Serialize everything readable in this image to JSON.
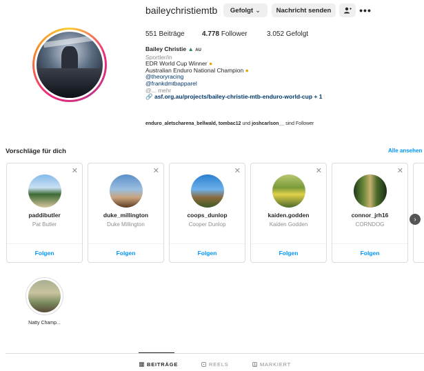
{
  "profile": {
    "username": "baileychristiemtb",
    "following_button": "Gefolgt",
    "message_button": "Nachricht senden",
    "more_icon": "more-icon",
    "stats": {
      "posts": "551 Beiträge",
      "followers_num": "4.778",
      "followers_label": "Follower",
      "following": "3.052 Gefolgt"
    },
    "bio": {
      "name": "Bailey Christie",
      "flag": "AU",
      "category": "Sportler/in",
      "line1": "EDR World Cup Winner",
      "line2": "Australian Enduro National Champion",
      "mention1": "@theoryracing",
      "mention2": "@frankdmtbapparel",
      "more": "@... mehr",
      "link": "asf.org.au/projects/bailey-christie-mtb-enduro-world-cup + 1"
    },
    "followed_by": {
      "users": "enduro_aletscharena_bellwald, tombac12",
      "conj": "und",
      "user3": "joshcarlson__",
      "suffix": "sind Follower"
    }
  },
  "suggestions": {
    "title": "Vorschläge für dich",
    "see_all": "Alle ansehen",
    "follow_label": "Folgen",
    "cards": [
      {
        "username": "paddibutler",
        "name": "Pat Butler"
      },
      {
        "username": "duke_millington",
        "name": "Duke Millington"
      },
      {
        "username": "coops_dunlop",
        "name": "Cooper Dunlop"
      },
      {
        "username": "kaiden.godden",
        "name": "Kaiden Godden"
      },
      {
        "username": "connor_jrh16",
        "name": "CORNDOG"
      }
    ]
  },
  "highlights": [
    {
      "label": "Natty Champ..."
    }
  ],
  "tabs": [
    {
      "label": "BEITRÄGE"
    },
    {
      "label": "REELS"
    },
    {
      "label": "MARKIERT"
    }
  ]
}
